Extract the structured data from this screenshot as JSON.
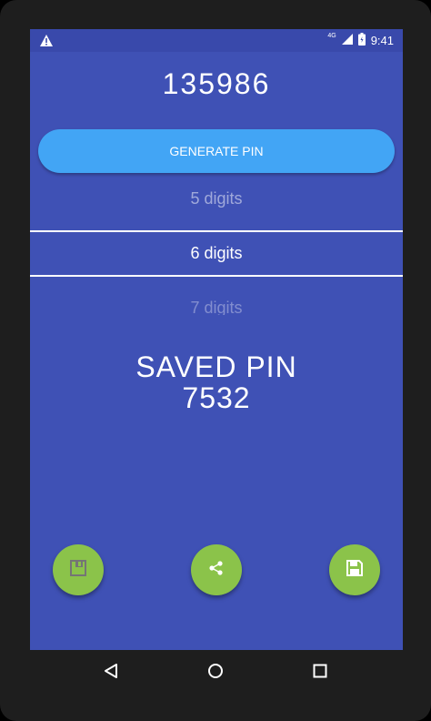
{
  "status_bar": {
    "warning_icon": "warning-icon",
    "network": "4G",
    "time": "9:41"
  },
  "pin": {
    "value": "135986"
  },
  "generate_button": {
    "label": "GENERATE PIN"
  },
  "digit_picker": {
    "options": [
      "5  digits",
      "6  digits",
      "7  digits"
    ],
    "selected": "6  digits"
  },
  "saved": {
    "title": "SAVED PIN",
    "value": "7532"
  },
  "actions": [
    {
      "icon": "copy-icon"
    },
    {
      "icon": "share-icon"
    },
    {
      "icon": "save-icon"
    }
  ],
  "colors": {
    "background": "#3f51b5",
    "status_bar": "#3949ab",
    "button": "#42a5f5",
    "fab": "#8bc34a"
  }
}
